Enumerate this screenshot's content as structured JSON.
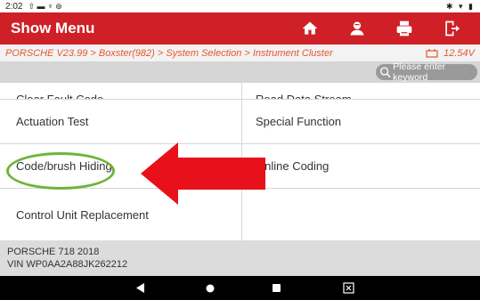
{
  "statusbar": {
    "time": "2:02",
    "indicators": "⇧ ▬ ♆ ⊛",
    "right_icons": "✱ ▾ ▮"
  },
  "header": {
    "title": "Show Menu",
    "buttons": [
      "home-icon",
      "person-icon",
      "print-icon",
      "exit-icon"
    ]
  },
  "breadcrumb": {
    "path": "PORSCHE V23.99 > Boxster(982) > System Selection > Instrument Cluster",
    "voltage": "12.54V"
  },
  "search": {
    "placeholder": "Please enter keyword"
  },
  "menu": {
    "items": [
      {
        "label": "Clear Fault Code"
      },
      {
        "label": "Read Data Stream"
      },
      {
        "label": "Actuation Test"
      },
      {
        "label": "Special Function"
      },
      {
        "label": "Code/brush Hiding"
      },
      {
        "label": "Online Coding"
      },
      {
        "label": "Control Unit Replacement"
      }
    ]
  },
  "footer": {
    "vehicle": "PORSCHE 718 2018",
    "vin": "VIN WP0AA2A88JK262212"
  },
  "annotation": {
    "highlight_color": "#6eb43a",
    "arrow_color": "#e8101a"
  },
  "colors": {
    "header": "#cf2027",
    "breadcrumb_text": "#e4572e"
  }
}
